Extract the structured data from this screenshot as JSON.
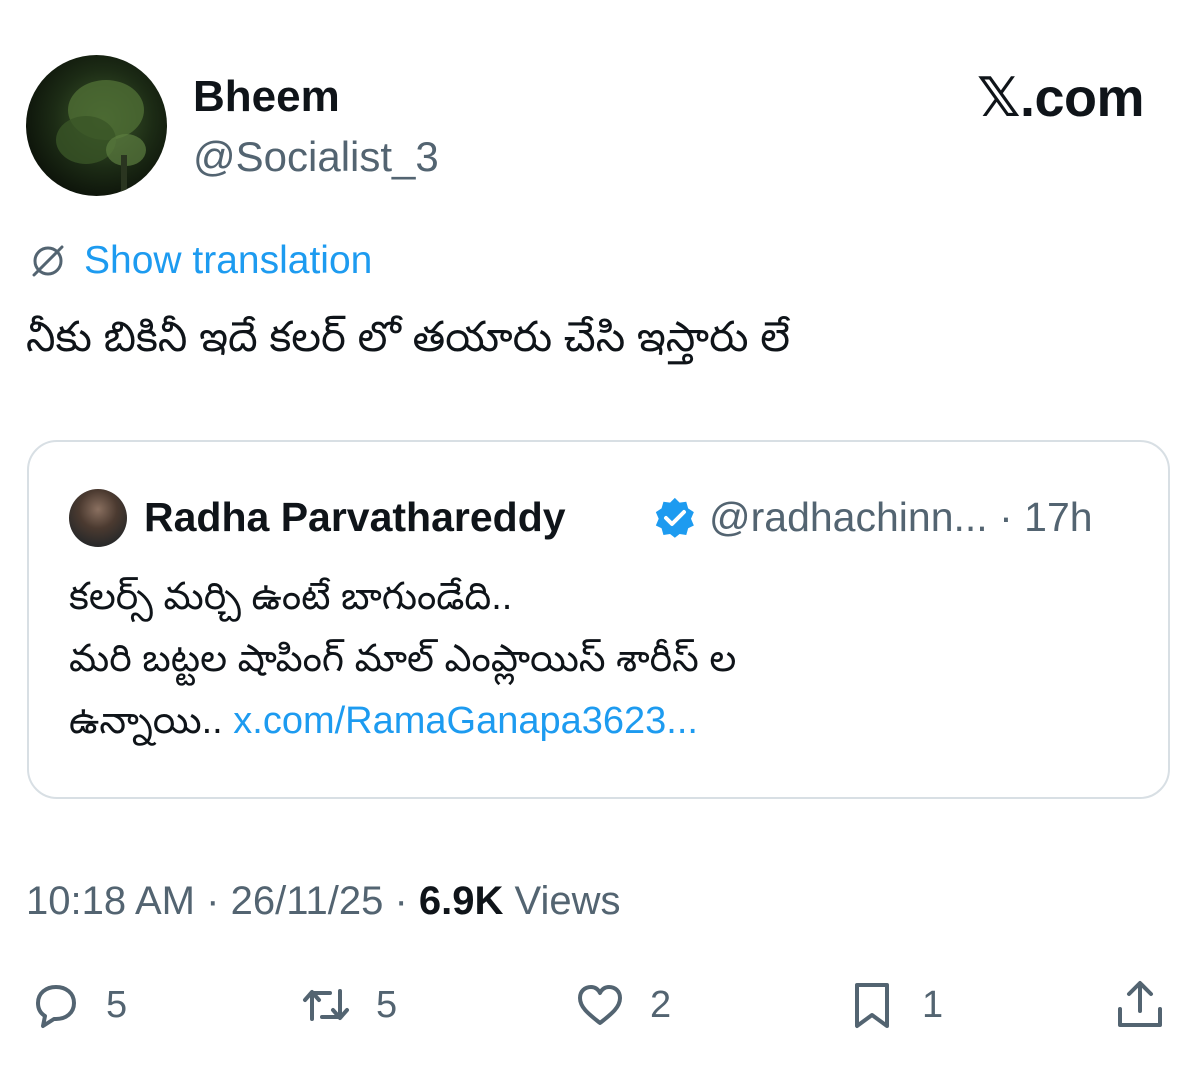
{
  "author": {
    "name": "Bheem",
    "handle": "@Socialist_3"
  },
  "brand": "𝕏.com",
  "translate_label": "Show translation",
  "tweet_text": "నీకు బికినీ ఇదే కలర్ లో తయారు చేసి ఇస్తారు లే",
  "quote": {
    "name": "Radha Parvathareddy",
    "handle": "@radhachinn...",
    "separator": "·",
    "time": "17h",
    "lines": [
      "కలర్స్ మర్చి ఉంటే బాగుండేది..",
      "మరి బట్టల షాపింగ్ మాల్ ఎంప్లాయిస్ శారీస్ ల",
      "ఉన్నాయి.."
    ],
    "link": "x.com/RamaGanapa3623..."
  },
  "meta": {
    "time": "10:18 AM",
    "separator": "·",
    "date": "26/11/25",
    "views_count": "6.9K",
    "views_label": "Views"
  },
  "actions": {
    "replies": "5",
    "reposts": "5",
    "likes": "2",
    "bookmarks": "1"
  },
  "colors": {
    "link": "#1d9bf0",
    "secondary": "#536471",
    "primary": "#0f1419",
    "border": "#d8dfe4"
  }
}
